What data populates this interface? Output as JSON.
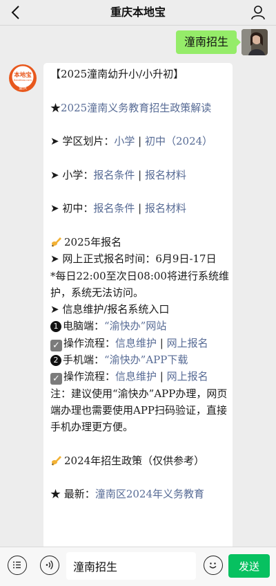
{
  "header": {
    "title": "重庆本地宝"
  },
  "sent_message": {
    "text": "潼南招生"
  },
  "bot_avatar": {
    "top_text": "本地宝",
    "sub_text": "Bendibao.com",
    "badge": "重庆"
  },
  "message": {
    "title": "【2025潼南幼升小/小升初】",
    "star": "★",
    "policy_link": "2025潼南义务教育招生政策解读",
    "arrow": "➤",
    "district_label": "学区划片：",
    "district_link1": "小学",
    "sep": " | ",
    "district_link2": "初中（2024）",
    "primary_label": "小学：",
    "primary_link1": "报名条件",
    "primary_link2": "报名材料",
    "junior_label": "初中：",
    "junior_link1": "报名条件",
    "junior_link2": "报名材料",
    "reg2025_heading": "2025年报名",
    "online_time": "网上正式报名时间：6月9日-17日",
    "maintenance": "*每日22:00至次日08:00将进行系统维护，系统无法访问。",
    "portal": "信息维护/报名系统入口",
    "pc_num": "1",
    "pc_label": "电脑端：",
    "pc_link": "“渝快办”网站",
    "flow_label": "操作流程：",
    "flow_link1": "信息维护",
    "flow_link2": "网上报名",
    "mobile_num": "2",
    "mobile_label": "手机端：",
    "mobile_link": "“渝快办”APP下载",
    "note": "注：建议使用“渝快办”APP办理，网页端办理也需要使用APP扫码验证，直接手机办理更方便。",
    "policy2024_heading": "2024年招生政策（仅供参考）",
    "latest_label": "最新：",
    "latest_link": "潼南区2024年义务教育"
  },
  "bottom": {
    "input_value": "潼南招生",
    "send_label": "发送"
  },
  "colors": {
    "link": "#576b95",
    "sent_bubble": "#95ec69",
    "send_button": "#07c160",
    "bot_orange": "#e8581d"
  }
}
